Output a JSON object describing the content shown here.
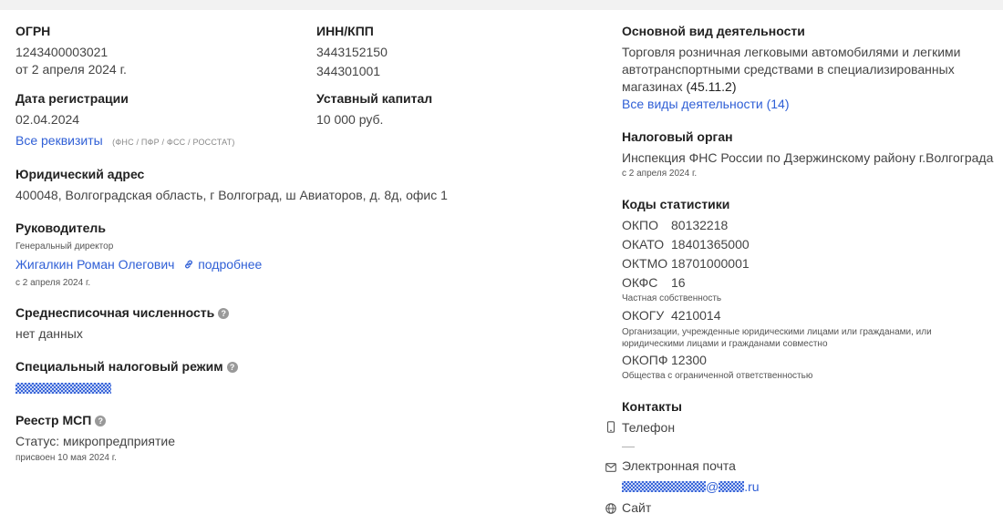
{
  "ogrn": {
    "label": "ОГРН",
    "value": "1243400003021",
    "date": "от 2 апреля 2024 г."
  },
  "inn_kpp": {
    "label": "ИНН/КПП",
    "inn": "3443152150",
    "kpp": "344301001"
  },
  "reg_date": {
    "label": "Дата регистрации",
    "value": "02.04.2024"
  },
  "capital": {
    "label": "Уставный капитал",
    "value": "10 000 руб."
  },
  "requisites": {
    "link": "Все реквизиты",
    "note": "(ФНС / ПФР / ФСС / РОССТАТ)"
  },
  "address": {
    "label": "Юридический адрес",
    "value": "400048, Волгоградская область, г Волгоград, ш Авиаторов, д. 8д, офис 1"
  },
  "head": {
    "label": "Руководитель",
    "position": "Генеральный директор",
    "name": "Жигалкин Роман Олегович",
    "more": "подробнее",
    "since": "с 2 апреля 2024 г."
  },
  "headcount": {
    "label": "Среднесписочная численность",
    "value": "нет данных"
  },
  "tax_regime": {
    "label": "Специальный налоговый режим"
  },
  "msp": {
    "label": "Реестр МСП",
    "status": "Статус: микропредприятие",
    "assigned": "присвоен 10 мая 2024 г."
  },
  "activity": {
    "label": "Основной вид деятельности",
    "line1": "Торговля розничная легковыми автомобилями и легкими",
    "line2": "автотранспортными средствами в специализированных",
    "line3": "магазинах",
    "code": "(45.11.2)",
    "all_link": "Все виды деятельности (14)"
  },
  "tax_office": {
    "label": "Налоговый орган",
    "value": "Инспекция ФНС России по Дзержинскому району г.Волгограда",
    "since": "с 2 апреля 2024 г."
  },
  "stats": {
    "label": "Коды статистики",
    "okpo": {
      "code": "ОКПО",
      "value": "80132218"
    },
    "okato": {
      "code": "ОКАТО",
      "value": "18401365000"
    },
    "oktmo": {
      "code": "ОКТМО",
      "value": "18701000001"
    },
    "okfs": {
      "code": "ОКФС",
      "value": "16",
      "desc": "Частная собственность"
    },
    "okogu": {
      "code": "ОКОГУ",
      "value": "4210014",
      "desc1": "Организации, учрежденные юридическими лицами или гражданами, или",
      "desc2": "юридическими лицами и гражданами совместно"
    },
    "okopf": {
      "code": "ОКОПФ",
      "value": "12300",
      "desc": "Общества с ограниченной ответственностью"
    }
  },
  "contacts": {
    "label": "Контакты",
    "phone_label": "Телефон",
    "phone_value": "—",
    "email_label": "Электронная почта",
    "email_at": "@",
    "email_tld": ".ru",
    "site_label": "Сайт"
  },
  "colors": {
    "link": "#2f5fd6",
    "heading": "#222222",
    "text": "#444444",
    "muted": "#888888"
  }
}
